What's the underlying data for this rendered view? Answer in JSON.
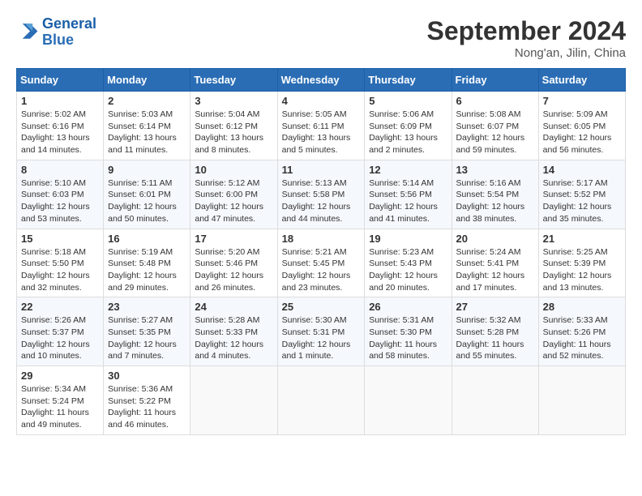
{
  "header": {
    "logo_line1": "General",
    "logo_line2": "Blue",
    "month_title": "September 2024",
    "location": "Nong'an, Jilin, China"
  },
  "weekdays": [
    "Sunday",
    "Monday",
    "Tuesday",
    "Wednesday",
    "Thursday",
    "Friday",
    "Saturday"
  ],
  "weeks": [
    [
      {
        "day": "1",
        "text": "Sunrise: 5:02 AM\nSunset: 6:16 PM\nDaylight: 13 hours and 14 minutes."
      },
      {
        "day": "2",
        "text": "Sunrise: 5:03 AM\nSunset: 6:14 PM\nDaylight: 13 hours and 11 minutes."
      },
      {
        "day": "3",
        "text": "Sunrise: 5:04 AM\nSunset: 6:12 PM\nDaylight: 13 hours and 8 minutes."
      },
      {
        "day": "4",
        "text": "Sunrise: 5:05 AM\nSunset: 6:11 PM\nDaylight: 13 hours and 5 minutes."
      },
      {
        "day": "5",
        "text": "Sunrise: 5:06 AM\nSunset: 6:09 PM\nDaylight: 13 hours and 2 minutes."
      },
      {
        "day": "6",
        "text": "Sunrise: 5:08 AM\nSunset: 6:07 PM\nDaylight: 12 hours and 59 minutes."
      },
      {
        "day": "7",
        "text": "Sunrise: 5:09 AM\nSunset: 6:05 PM\nDaylight: 12 hours and 56 minutes."
      }
    ],
    [
      {
        "day": "8",
        "text": "Sunrise: 5:10 AM\nSunset: 6:03 PM\nDaylight: 12 hours and 53 minutes."
      },
      {
        "day": "9",
        "text": "Sunrise: 5:11 AM\nSunset: 6:01 PM\nDaylight: 12 hours and 50 minutes."
      },
      {
        "day": "10",
        "text": "Sunrise: 5:12 AM\nSunset: 6:00 PM\nDaylight: 12 hours and 47 minutes."
      },
      {
        "day": "11",
        "text": "Sunrise: 5:13 AM\nSunset: 5:58 PM\nDaylight: 12 hours and 44 minutes."
      },
      {
        "day": "12",
        "text": "Sunrise: 5:14 AM\nSunset: 5:56 PM\nDaylight: 12 hours and 41 minutes."
      },
      {
        "day": "13",
        "text": "Sunrise: 5:16 AM\nSunset: 5:54 PM\nDaylight: 12 hours and 38 minutes."
      },
      {
        "day": "14",
        "text": "Sunrise: 5:17 AM\nSunset: 5:52 PM\nDaylight: 12 hours and 35 minutes."
      }
    ],
    [
      {
        "day": "15",
        "text": "Sunrise: 5:18 AM\nSunset: 5:50 PM\nDaylight: 12 hours and 32 minutes."
      },
      {
        "day": "16",
        "text": "Sunrise: 5:19 AM\nSunset: 5:48 PM\nDaylight: 12 hours and 29 minutes."
      },
      {
        "day": "17",
        "text": "Sunrise: 5:20 AM\nSunset: 5:46 PM\nDaylight: 12 hours and 26 minutes."
      },
      {
        "day": "18",
        "text": "Sunrise: 5:21 AM\nSunset: 5:45 PM\nDaylight: 12 hours and 23 minutes."
      },
      {
        "day": "19",
        "text": "Sunrise: 5:23 AM\nSunset: 5:43 PM\nDaylight: 12 hours and 20 minutes."
      },
      {
        "day": "20",
        "text": "Sunrise: 5:24 AM\nSunset: 5:41 PM\nDaylight: 12 hours and 17 minutes."
      },
      {
        "day": "21",
        "text": "Sunrise: 5:25 AM\nSunset: 5:39 PM\nDaylight: 12 hours and 13 minutes."
      }
    ],
    [
      {
        "day": "22",
        "text": "Sunrise: 5:26 AM\nSunset: 5:37 PM\nDaylight: 12 hours and 10 minutes."
      },
      {
        "day": "23",
        "text": "Sunrise: 5:27 AM\nSunset: 5:35 PM\nDaylight: 12 hours and 7 minutes."
      },
      {
        "day": "24",
        "text": "Sunrise: 5:28 AM\nSunset: 5:33 PM\nDaylight: 12 hours and 4 minutes."
      },
      {
        "day": "25",
        "text": "Sunrise: 5:30 AM\nSunset: 5:31 PM\nDaylight: 12 hours and 1 minute."
      },
      {
        "day": "26",
        "text": "Sunrise: 5:31 AM\nSunset: 5:30 PM\nDaylight: 11 hours and 58 minutes."
      },
      {
        "day": "27",
        "text": "Sunrise: 5:32 AM\nSunset: 5:28 PM\nDaylight: 11 hours and 55 minutes."
      },
      {
        "day": "28",
        "text": "Sunrise: 5:33 AM\nSunset: 5:26 PM\nDaylight: 11 hours and 52 minutes."
      }
    ],
    [
      {
        "day": "29",
        "text": "Sunrise: 5:34 AM\nSunset: 5:24 PM\nDaylight: 11 hours and 49 minutes."
      },
      {
        "day": "30",
        "text": "Sunrise: 5:36 AM\nSunset: 5:22 PM\nDaylight: 11 hours and 46 minutes."
      },
      {
        "day": "",
        "text": ""
      },
      {
        "day": "",
        "text": ""
      },
      {
        "day": "",
        "text": ""
      },
      {
        "day": "",
        "text": ""
      },
      {
        "day": "",
        "text": ""
      }
    ]
  ]
}
